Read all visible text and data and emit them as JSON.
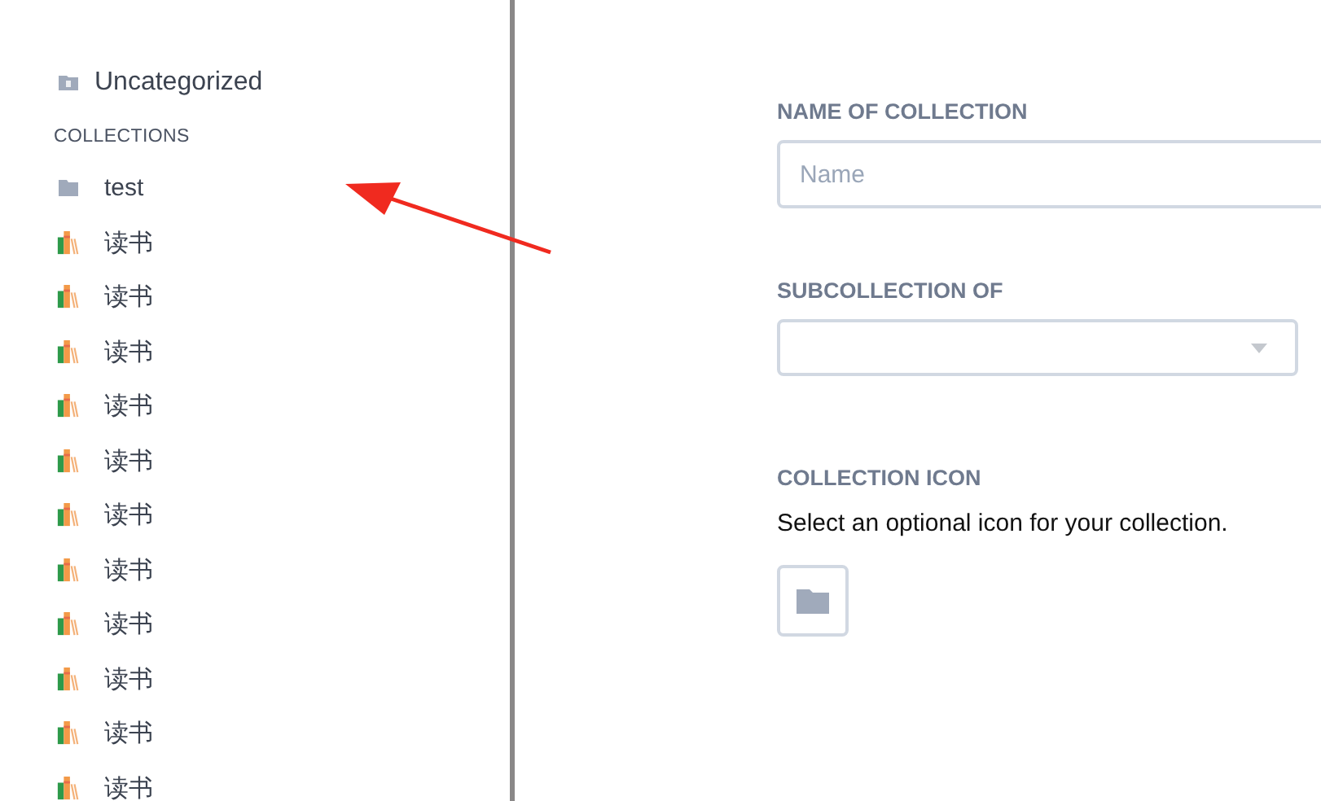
{
  "sidebar": {
    "uncategorized": {
      "label": "Uncategorized",
      "kind": "unknown"
    },
    "section_title": "COLLECTIONS",
    "items": [
      {
        "label": "test",
        "kind": "folder"
      },
      {
        "label": "读书",
        "kind": "books"
      },
      {
        "label": "读书",
        "kind": "books"
      },
      {
        "label": "读书",
        "kind": "books"
      },
      {
        "label": "读书",
        "kind": "books"
      },
      {
        "label": "读书",
        "kind": "books"
      },
      {
        "label": "读书",
        "kind": "books"
      },
      {
        "label": "读书",
        "kind": "books"
      },
      {
        "label": "读书",
        "kind": "books"
      },
      {
        "label": "读书",
        "kind": "books"
      },
      {
        "label": "读书",
        "kind": "books"
      },
      {
        "label": "读书",
        "kind": "books"
      }
    ]
  },
  "form": {
    "name_label": "NAME OF COLLECTION",
    "name_placeholder": "Name",
    "parent_label": "SUBCOLLECTION OF",
    "icon_label": "COLLECTION ICON",
    "icon_hint": "Select an optional icon for your collection."
  }
}
